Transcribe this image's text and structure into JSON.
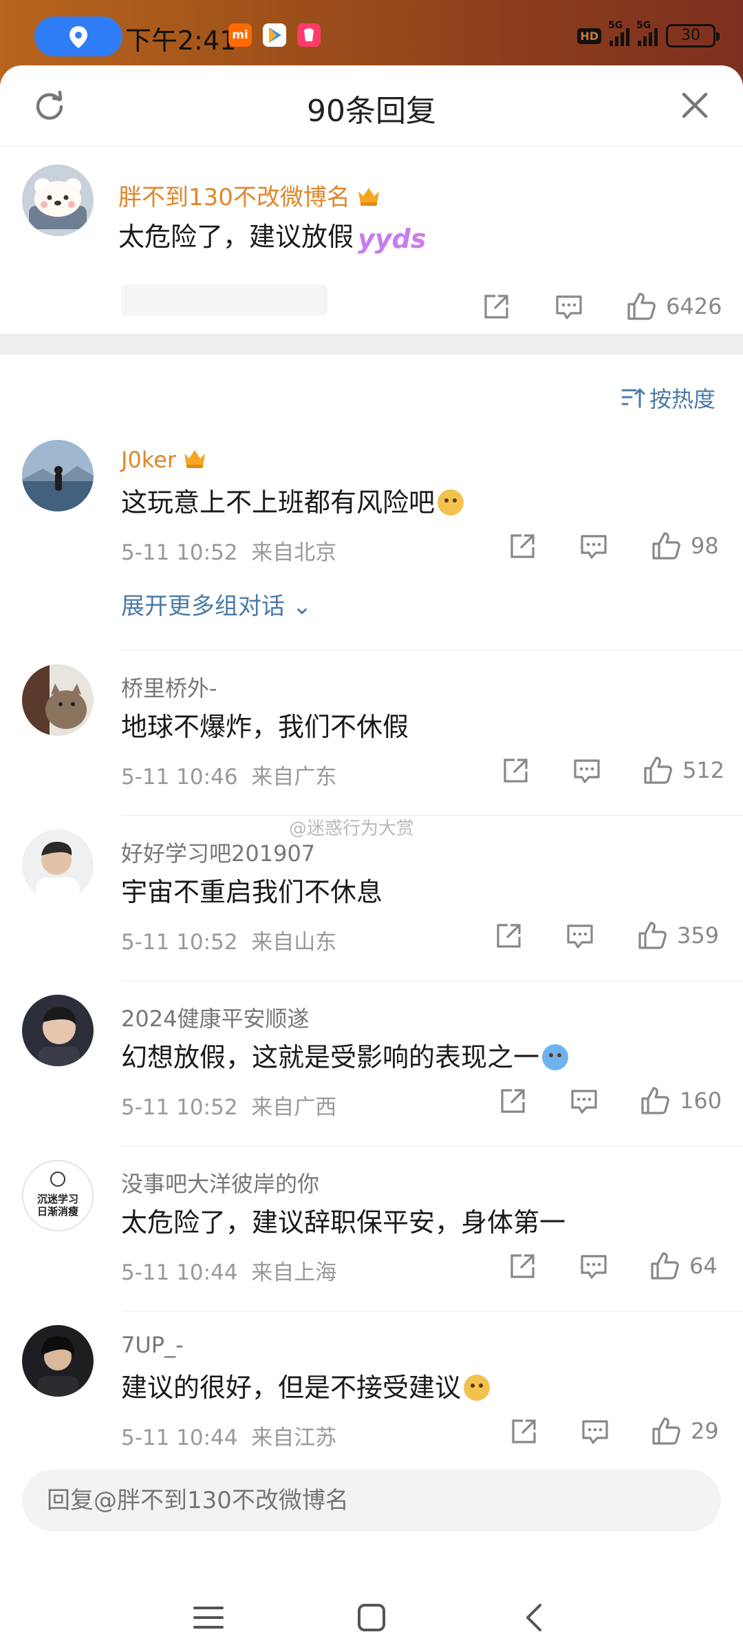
{
  "status_bar": {
    "time": "下午2:41",
    "battery": "30",
    "network_label": "5G",
    "hd_label": "HD"
  },
  "sheet": {
    "title": "90条回复"
  },
  "root_comment": {
    "user": "胖不到130不改微博名",
    "text": "太危险了，建议放假",
    "sticker": "yyds",
    "likes": "6426",
    "avatar_icon": "bear-avatar-icon"
  },
  "sort": {
    "label": "按热度"
  },
  "comments": [
    {
      "user": "J0ker",
      "vip": true,
      "text": "这玩意上不上班都有风险吧",
      "emoji": "doge-emoji",
      "time": "5-11 10:52",
      "location": "来自北京",
      "likes": "98",
      "expand": "展开更多组对话"
    },
    {
      "user": "桥里桥外-",
      "text": "地球不爆炸，我们不休假",
      "time": "5-11 10:46",
      "location": "来自广东",
      "likes": "512"
    },
    {
      "user": "好好学习吧201907",
      "text": "宇宙不重启我们不休息",
      "time": "5-11 10:52",
      "location": "来自山东",
      "likes": "359"
    },
    {
      "user": "2024健康平安顺遂",
      "text": "幻想放假，这就是受影响的表现之一",
      "emoji": "crying-emoji",
      "time": "5-11 10:52",
      "location": "来自广西",
      "likes": "160"
    },
    {
      "user": "没事吧大洋彼岸的你",
      "text": "太危险了，建议辞职保平安，身体第一",
      "avatar_text": "沉迷学习\n日渐消瘦",
      "time": "5-11 10:44",
      "location": "来自上海",
      "likes": "64"
    },
    {
      "user": "7UP_-",
      "text": "建议的很好，但是不接受建议",
      "emoji": "doge-emoji",
      "time": "5-11 10:44",
      "location": "来自江苏",
      "likes": "29"
    }
  ],
  "watermark": "@迷惑行为大赏",
  "reply_input": {
    "placeholder": "回复@胖不到130不改微博名"
  },
  "colors": {
    "vip_name": "#e0862a",
    "link_blue": "#4a7aa8",
    "meta_gray": "#999999",
    "status_bar_bg": "#a0521a"
  }
}
